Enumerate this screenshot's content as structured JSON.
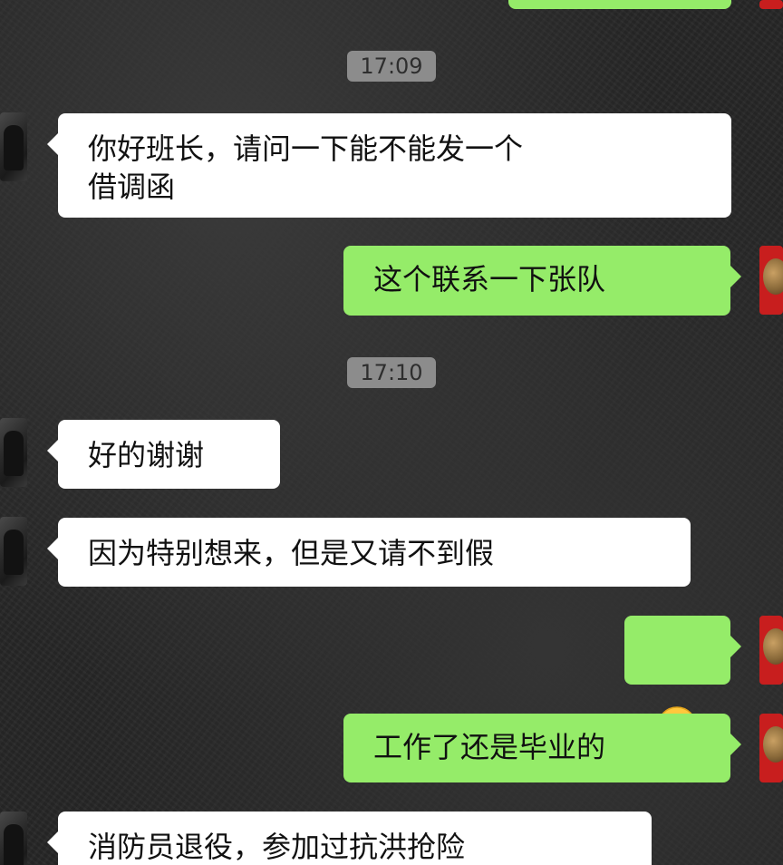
{
  "timestamps": [
    "17:09",
    "17:10"
  ],
  "messages": [
    {
      "from": "other",
      "text": "你好班长，请问一下能不能发一个\n借调函"
    },
    {
      "from": "me",
      "text": "这个联系一下张队"
    },
    {
      "from": "other",
      "text": "好的谢谢"
    },
    {
      "from": "other",
      "text": "因为特别想来，但是又请不到假"
    },
    {
      "from": "me",
      "emoji": "grinning-face"
    },
    {
      "from": "me",
      "text": "工作了还是毕业的"
    },
    {
      "from": "other",
      "text": "消防员退役，参加过抗洪抢险"
    }
  ],
  "colors": {
    "outgoing_bubble": "#95ec69",
    "incoming_bubble": "#ffffff",
    "timestamp_bg": "#8c8c8c",
    "background": "#262626"
  }
}
